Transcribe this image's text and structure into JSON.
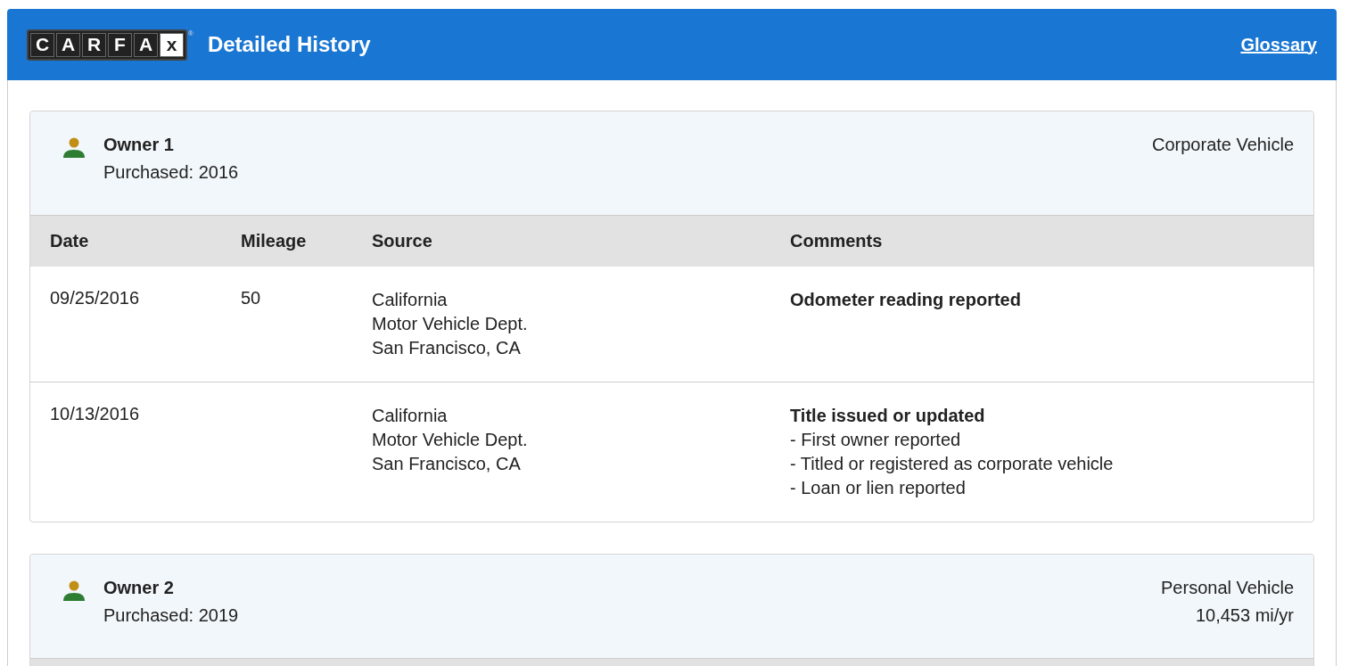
{
  "header": {
    "logo_letters": [
      "C",
      "A",
      "R",
      "F",
      "A",
      "x"
    ],
    "logo_mark": "®",
    "title": "Detailed History",
    "link": "Glossary"
  },
  "owners": [
    {
      "name": "Owner 1",
      "purchased": "Purchased: 2016",
      "details": [
        "Corporate Vehicle"
      ],
      "columns": [
        "Date",
        "Mileage",
        "Source",
        "Comments"
      ],
      "rows": [
        {
          "date": "09/25/2016",
          "mileage": "50",
          "source": [
            "California",
            "Motor Vehicle Dept.",
            "San Francisco, CA"
          ],
          "comment_title": "Odometer reading reported",
          "comment_items": []
        },
        {
          "date": "10/13/2016",
          "mileage": "",
          "source": [
            "California",
            "Motor Vehicle Dept.",
            "San Francisco, CA"
          ],
          "comment_title": "Title issued or updated",
          "comment_items": [
            "- First owner reported",
            "- Titled or registered as corporate vehicle",
            "- Loan or lien reported"
          ]
        }
      ]
    },
    {
      "name": "Owner 2",
      "purchased": "Purchased: 2019",
      "details": [
        "Personal Vehicle",
        "10,453 mi/yr"
      ]
    }
  ]
}
